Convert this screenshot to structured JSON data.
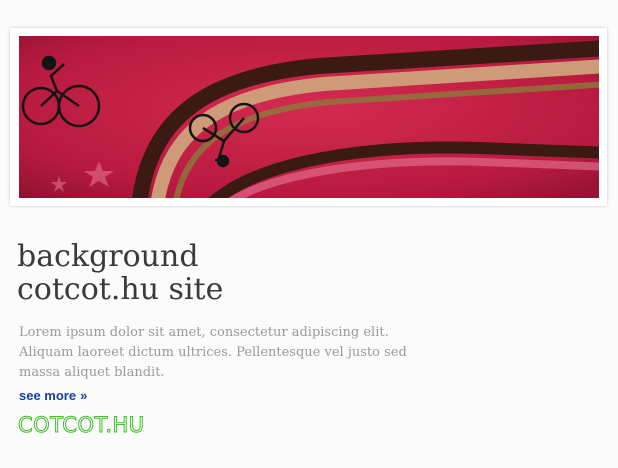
{
  "banner": {
    "alt_description_icons": [
      "cyclist-icon",
      "bicycle-icon"
    ],
    "colors": {
      "background": "#c21f45",
      "stripe_tan": "#cf9a78",
      "stripe_dark": "#3a1a12",
      "stripe_olive": "#8b7a3a",
      "stripe_pink": "#e06a8a"
    }
  },
  "content": {
    "title_line1": "background",
    "title_line2": "cotcot.hu site",
    "body": "Lorem ipsum dolor sit amet, consectetur adipiscing elit. Aliquam laoreet dictum ultrices. Pellentesque vel justo sed massa aliquet blandit.",
    "see_more_label": "see more",
    "see_more_arrow": "»"
  },
  "logo": {
    "text": "COTCOT.HU",
    "color": "#3fbf27"
  }
}
